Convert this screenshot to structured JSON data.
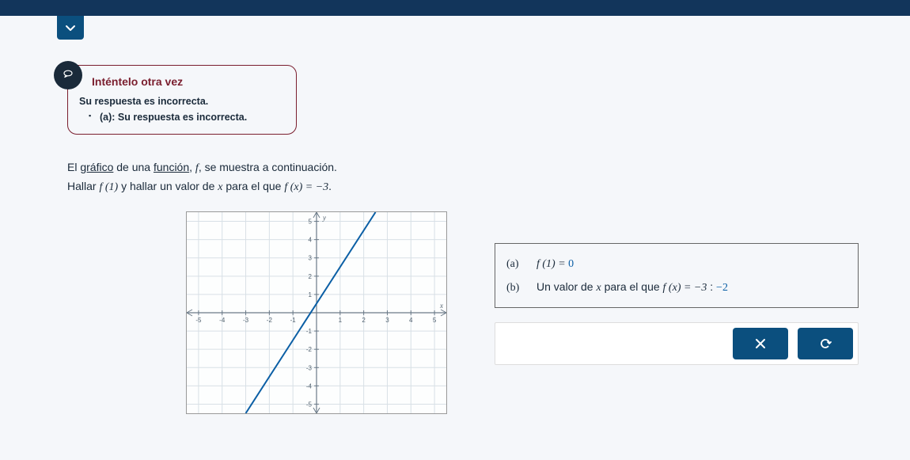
{
  "feedback": {
    "title": "Inténtelo otra vez",
    "sub": "Su respuesta es incorrecta.",
    "bullet": "(a): Su respuesta es incorrecta."
  },
  "problem": {
    "line1_pre": "El ",
    "line1_link1": "gráfico",
    "line1_mid": " de una ",
    "line1_link2": "función",
    "line1_post": ", ",
    "line1_f": "f",
    "line1_end": ", se muestra a continuación.",
    "line2_pre": "Hallar ",
    "line2_f1": "f (1)",
    "line2_mid": " y hallar un valor de ",
    "line2_x": "x",
    "line2_mid2": " para el que ",
    "line2_fx": "f (x) = −3",
    "line2_end": "."
  },
  "answers": {
    "a_label": "(a)",
    "a_expr": "f (1) = ",
    "a_value": "0",
    "b_label": "(b)",
    "b_text_pre": "Un valor de ",
    "b_x": "x",
    "b_text_mid": " para el que ",
    "b_fx": "f (x) = −3",
    "b_colon": " : ",
    "b_value": "−2"
  },
  "buttons": {
    "clear": "×",
    "reset": "↻"
  },
  "chart_data": {
    "type": "line",
    "title": "",
    "xlabel": "x",
    "ylabel": "y",
    "xlim": [
      -5.5,
      5.5
    ],
    "ylim": [
      -5.5,
      5.5
    ],
    "x_ticks": [
      -5,
      -4,
      -3,
      -2,
      -1,
      1,
      2,
      3,
      4,
      5
    ],
    "y_ticks": [
      -5,
      -4,
      -3,
      -2,
      -1,
      1,
      2,
      3,
      4,
      5
    ],
    "series": [
      {
        "name": "f",
        "color": "#0b5fa5",
        "x": [
          -3,
          2.5
        ],
        "y": [
          -5.5,
          5.5
        ]
      }
    ],
    "grid": true
  }
}
